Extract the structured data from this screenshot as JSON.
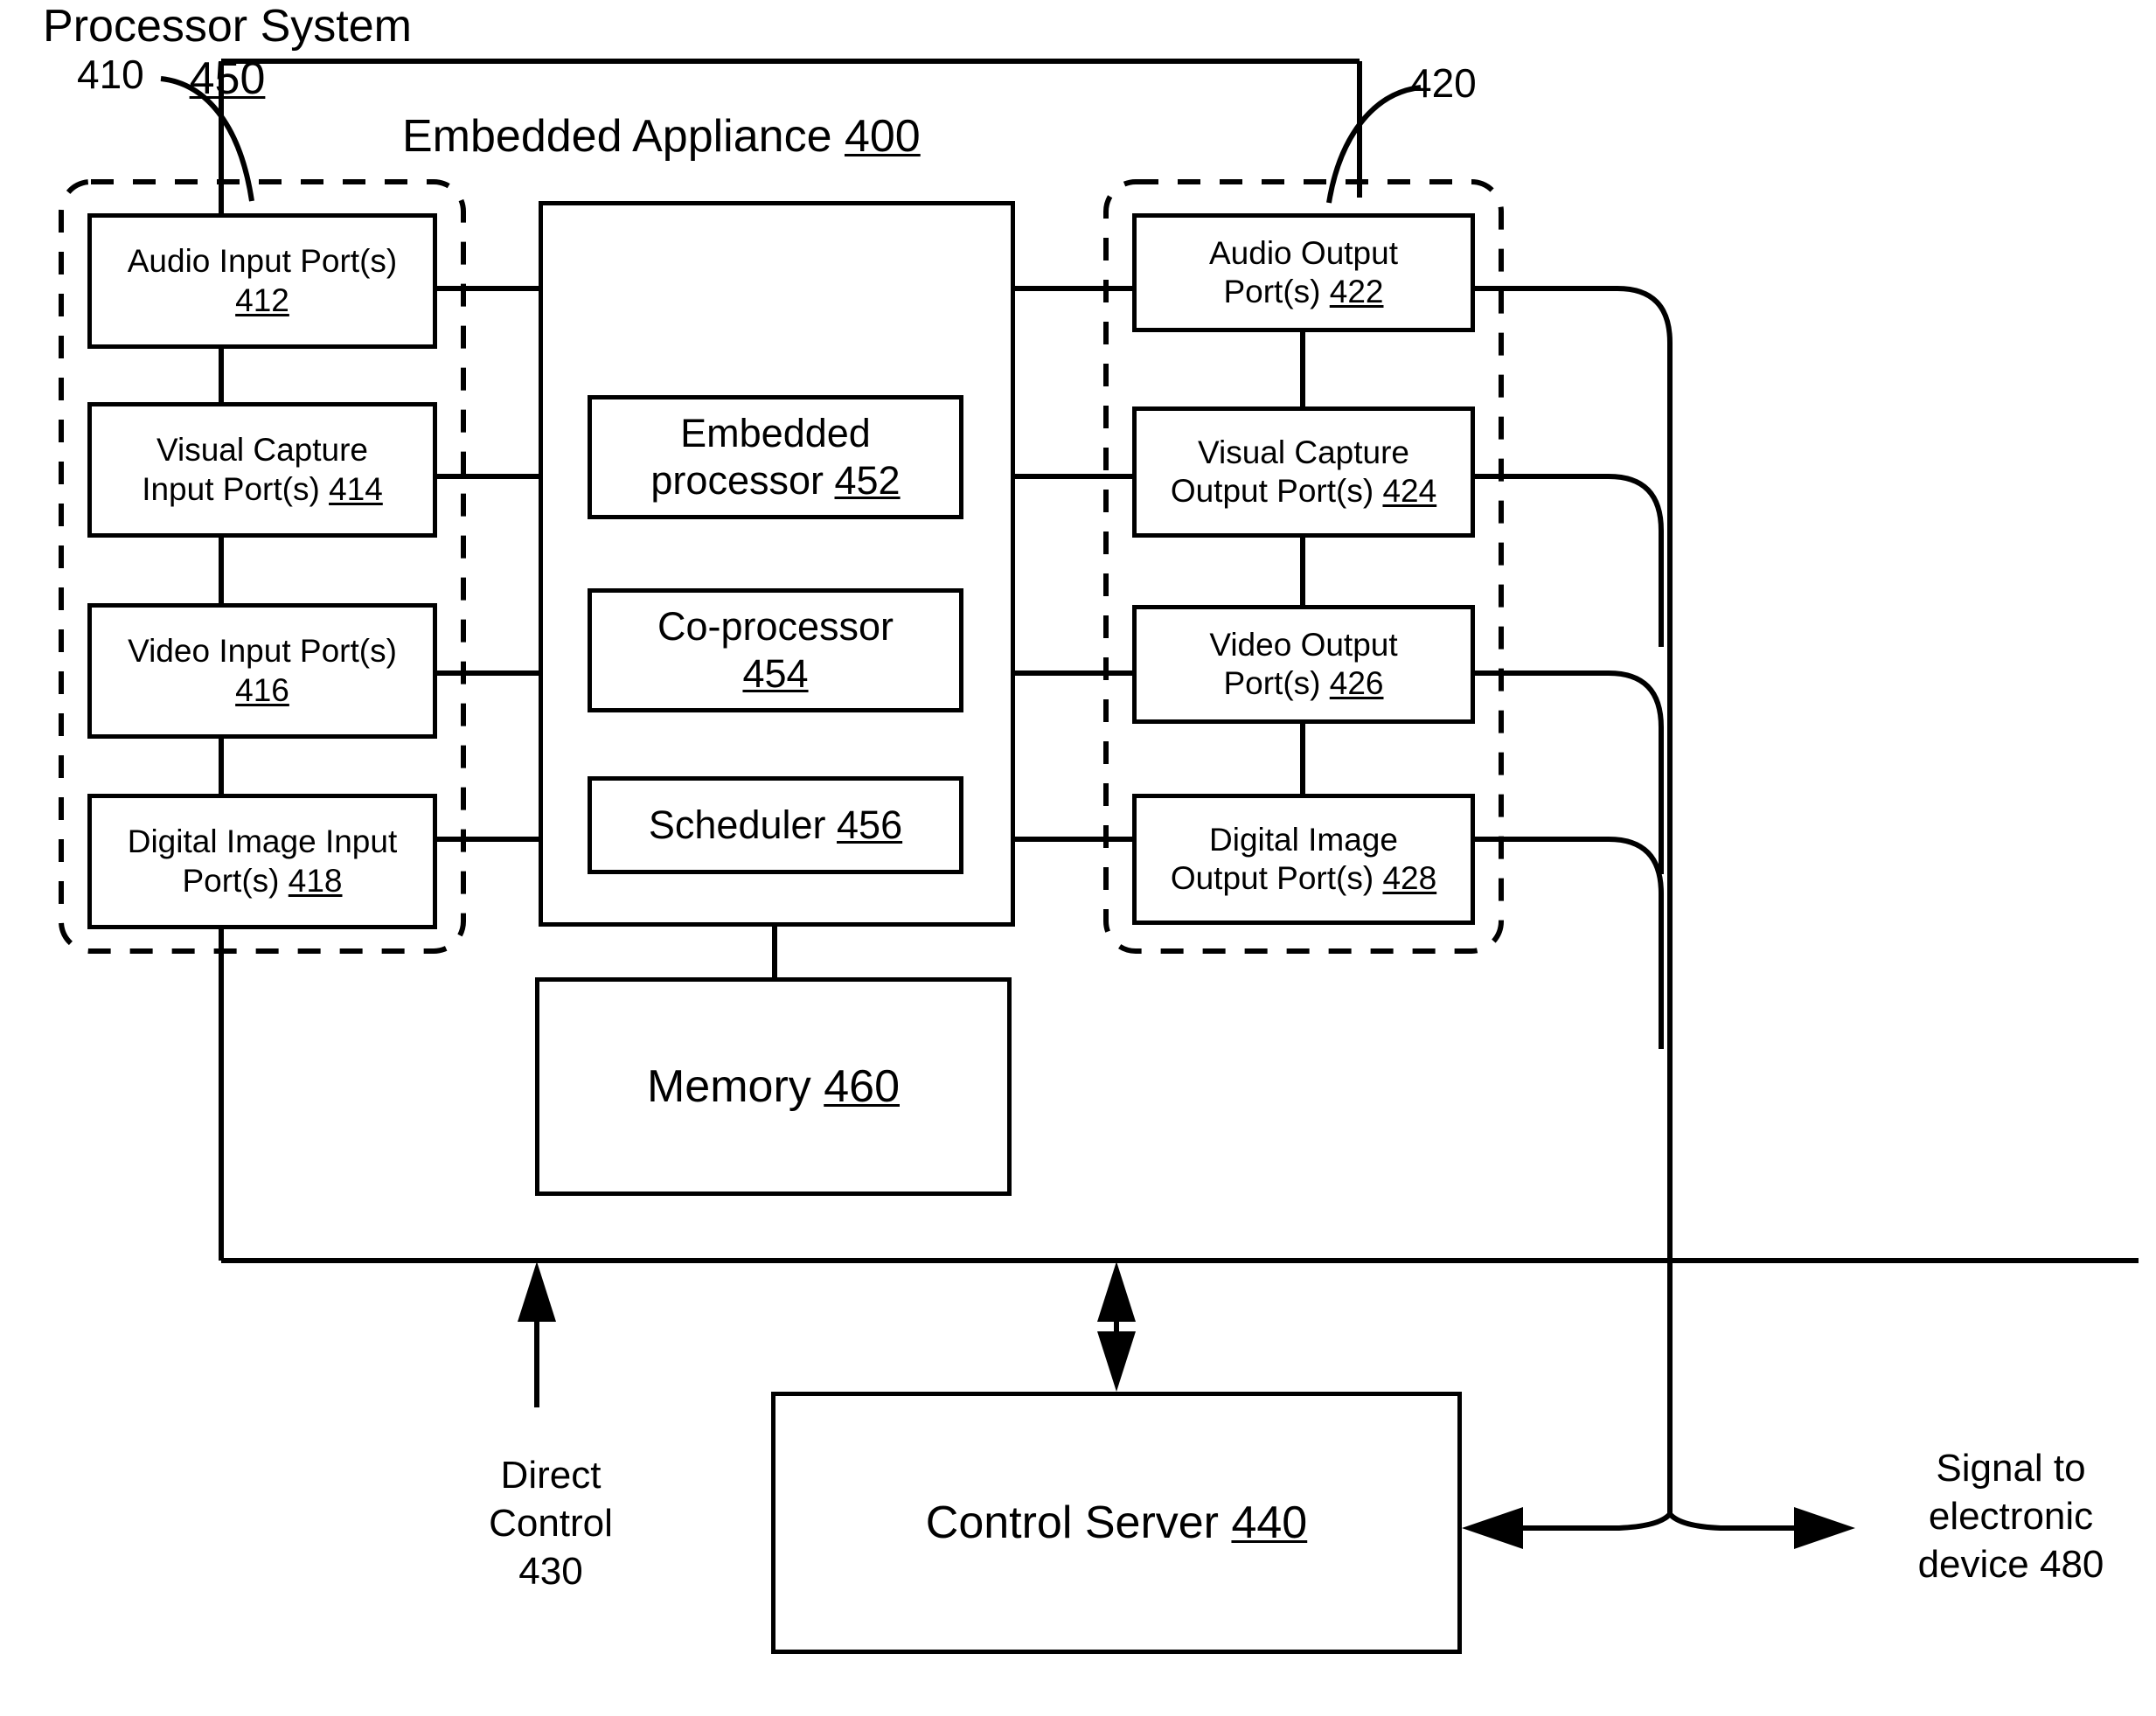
{
  "figure": {
    "title_text": "Embedded Appliance",
    "title_ref": "400",
    "callout_left": "410",
    "callout_right": "420"
  },
  "processor_system": {
    "title_text": "Processor System",
    "title_ref": "450",
    "components": [
      {
        "name": "Embedded processor",
        "ref": "452",
        "label": "Embedded\nprocessor 452"
      },
      {
        "name": "Co-processor",
        "ref": "454",
        "label": "Co-processor\n454"
      },
      {
        "name": "Scheduler",
        "ref": "456",
        "label": "Scheduler 456"
      }
    ]
  },
  "memory": {
    "label": "Memory",
    "ref": "460"
  },
  "input_ports": {
    "group_callout": "410",
    "items": [
      {
        "label": "Audio Input Port(s)",
        "ref": "412",
        "line1": "Audio Input Port(s)",
        "line2": "412"
      },
      {
        "label": "Visual Capture Input Port(s)",
        "ref": "414",
        "line1": "Visual Capture",
        "line2": "Input Port(s) 414"
      },
      {
        "label": "Video Input Port(s)",
        "ref": "416",
        "line1": "Video Input Port(s)",
        "line2": "416"
      },
      {
        "label": "Digital Image Input Port(s)",
        "ref": "418",
        "line1": "Digital Image Input",
        "line2": "Port(s) 418"
      }
    ]
  },
  "output_ports": {
    "group_callout": "420",
    "items": [
      {
        "label": "Audio Output Port(s)",
        "ref": "422",
        "line1": "Audio Output",
        "line2": "Port(s) 422"
      },
      {
        "label": "Visual Capture Output Port(s)",
        "ref": "424",
        "line1": "Visual Capture",
        "line2": "Output Port(s) 424"
      },
      {
        "label": "Video Output Port(s)",
        "ref": "426",
        "line1": "Video Output",
        "line2": "Port(s) 426"
      },
      {
        "label": "Digital Image Output Port(s)",
        "ref": "428",
        "line1": "Digital Image",
        "line2": "Output Port(s) 428"
      }
    ]
  },
  "control_server": {
    "label": "Control Server",
    "ref": "440"
  },
  "annotations": {
    "direct_control": "Direct\nControl\n430",
    "signal_to_device": "Signal to\nelectronic\ndevice 480"
  },
  "colors": {
    "line": "#000000",
    "background": "#ffffff"
  }
}
